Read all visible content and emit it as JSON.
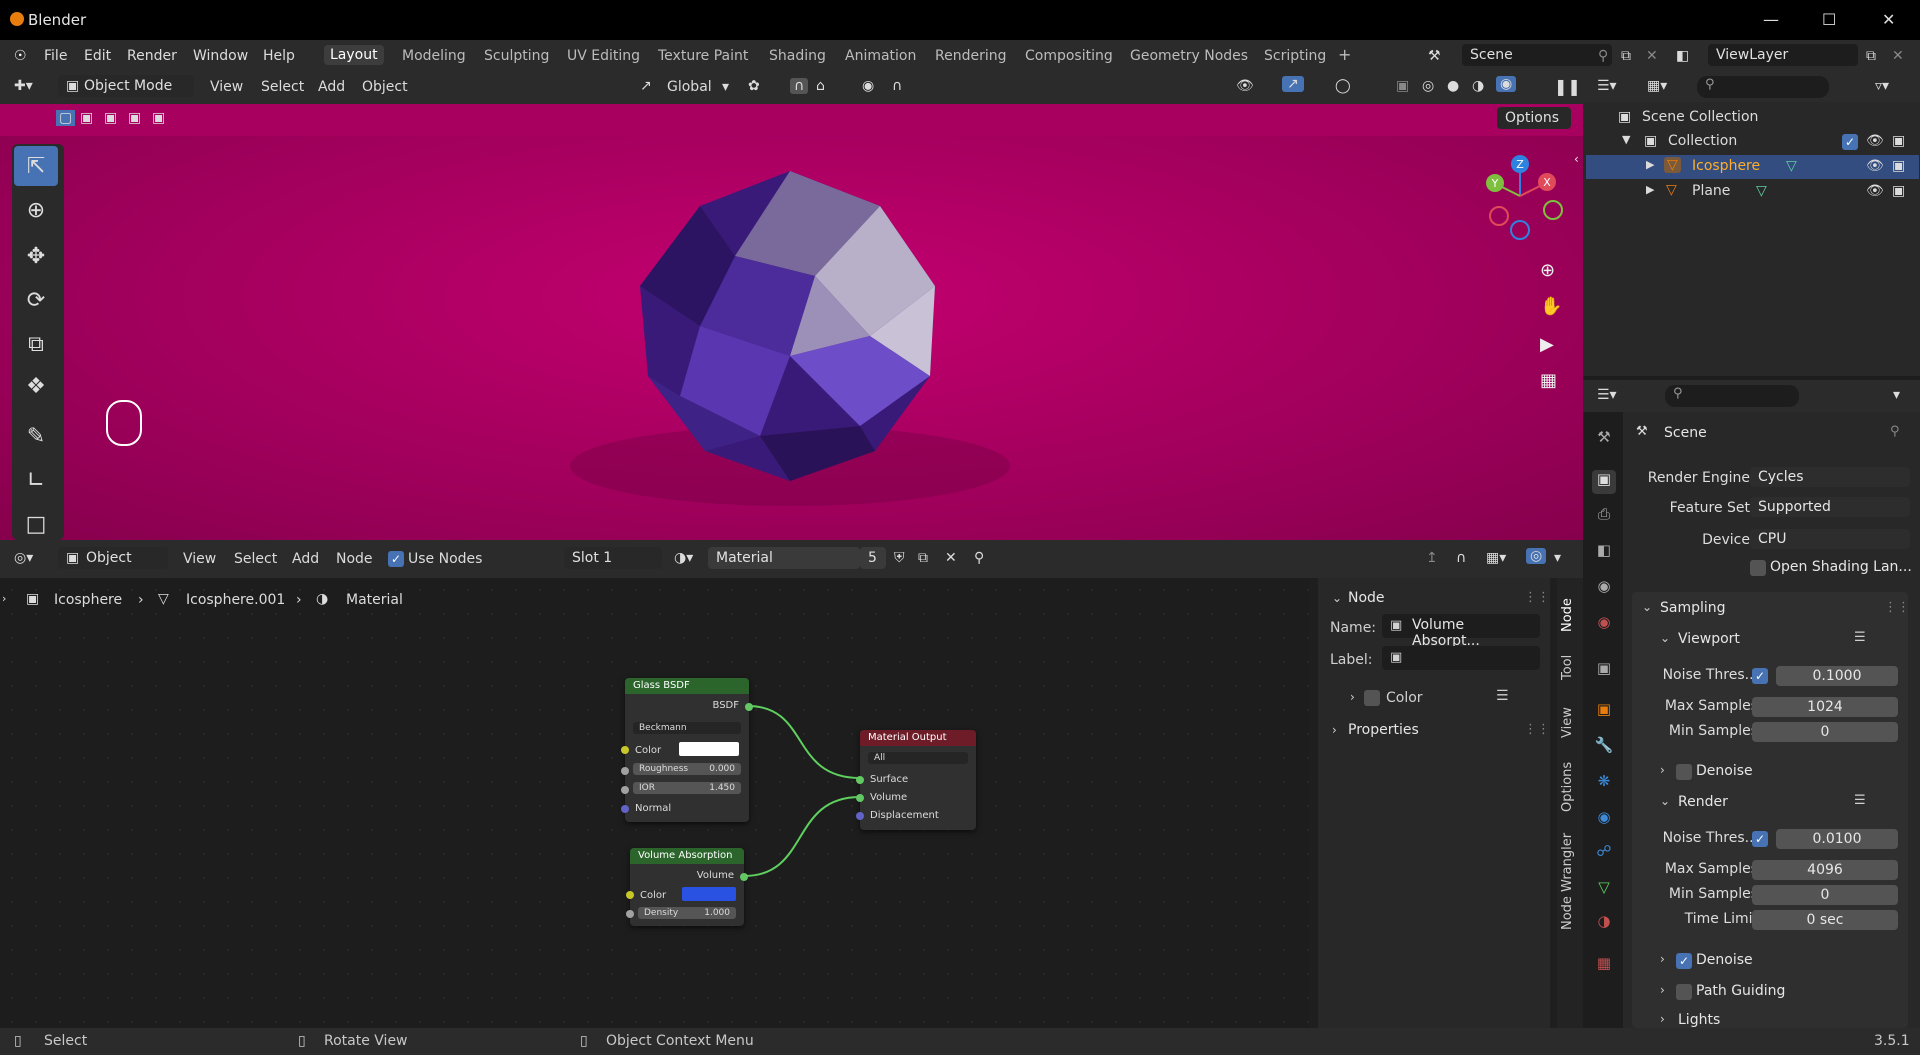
{
  "app": {
    "title": "Blender",
    "version": "3.5.1"
  },
  "menu": [
    "File",
    "Edit",
    "Render",
    "Window",
    "Help"
  ],
  "workspaces": [
    "Layout",
    "Modeling",
    "Sculpting",
    "UV Editing",
    "Texture Paint",
    "Shading",
    "Animation",
    "Rendering",
    "Compositing",
    "Geometry Nodes",
    "Scripting"
  ],
  "active_workspace": "Layout",
  "scene": {
    "name": "Scene",
    "view_layer": "ViewLayer"
  },
  "viewport": {
    "mode": "Object Mode",
    "menus": [
      "View",
      "Select",
      "Add",
      "Object"
    ],
    "orientation": "Global",
    "options_label": "Options",
    "gizmo": {
      "z": "Z",
      "y": "Y",
      "x": "X"
    }
  },
  "node_editor": {
    "type": "Object",
    "menus": [
      "View",
      "Select",
      "Add",
      "Node"
    ],
    "use_nodes_label": "Use Nodes",
    "use_nodes": true,
    "slot": "Slot 1",
    "material": "Material",
    "users": "5",
    "breadcrumb": [
      "Icosphere",
      "Icosphere.001",
      "Material"
    ],
    "nodes": {
      "glass": {
        "title": "Glass BSDF",
        "output": "BSDF",
        "distribution": "Beckmann",
        "color_label": "Color",
        "roughness_label": "Roughness",
        "roughness": "0.000",
        "ior_label": "IOR",
        "ior": "1.450",
        "normal_label": "Normal",
        "header_color": "#2b652b"
      },
      "output": {
        "title": "Material Output",
        "target": "All",
        "surface": "Surface",
        "volume": "Volume",
        "displacement": "Displacement",
        "header_color": "#6e1d28"
      },
      "volume": {
        "title": "Volume Absorption",
        "output": "Volume",
        "color_label": "Color",
        "density_label": "Density",
        "density": "1.000",
        "color": "#2952e3",
        "header_color": "#2b652b"
      }
    }
  },
  "npanel": {
    "node_section": "Node",
    "name_label": "Name:",
    "name_value": "Volume Absorpt...",
    "label_label": "Label:",
    "color_label": "Color",
    "properties_label": "Properties",
    "tabs": [
      "Node",
      "Tool",
      "View",
      "Options",
      "Node Wrangler"
    ]
  },
  "outliner": {
    "rows": [
      {
        "label": "Scene Collection"
      },
      {
        "label": "Collection"
      },
      {
        "label": "Icosphere"
      },
      {
        "label": "Plane"
      }
    ]
  },
  "properties": {
    "context": "Scene",
    "render_engine_label": "Render Engine",
    "render_engine": "Cycles",
    "feature_set_label": "Feature Set",
    "feature_set": "Supported",
    "device_label": "Device",
    "device": "CPU",
    "osl_label": "Open Shading Lan...",
    "sampling": "Sampling",
    "viewport": "Viewport",
    "vp_noise_label": "Noise Thres...",
    "vp_noise": "0.1000",
    "vp_max_label": "Max Samples",
    "vp_max": "1024",
    "vp_min_label": "Min Samples",
    "vp_min": "0",
    "denoise_label": "Denoise",
    "render": "Render",
    "r_noise_label": "Noise Thres...",
    "r_noise": "0.0100",
    "r_max_label": "Max Samples",
    "r_max": "4096",
    "r_min_label": "Min Samples",
    "r_min": "0",
    "time_limit_label": "Time Limit",
    "time_limit": "0 sec",
    "r_denoise_label": "Denoise",
    "path_guiding_label": "Path Guiding",
    "lights_label": "Lights"
  },
  "status": {
    "left": "Select",
    "middle": "Rotate View",
    "right": "Object Context Menu"
  },
  "colors": {
    "accent": "#4772b3",
    "viewport_bg": "#a3005d",
    "selected_row": "#334d80"
  }
}
